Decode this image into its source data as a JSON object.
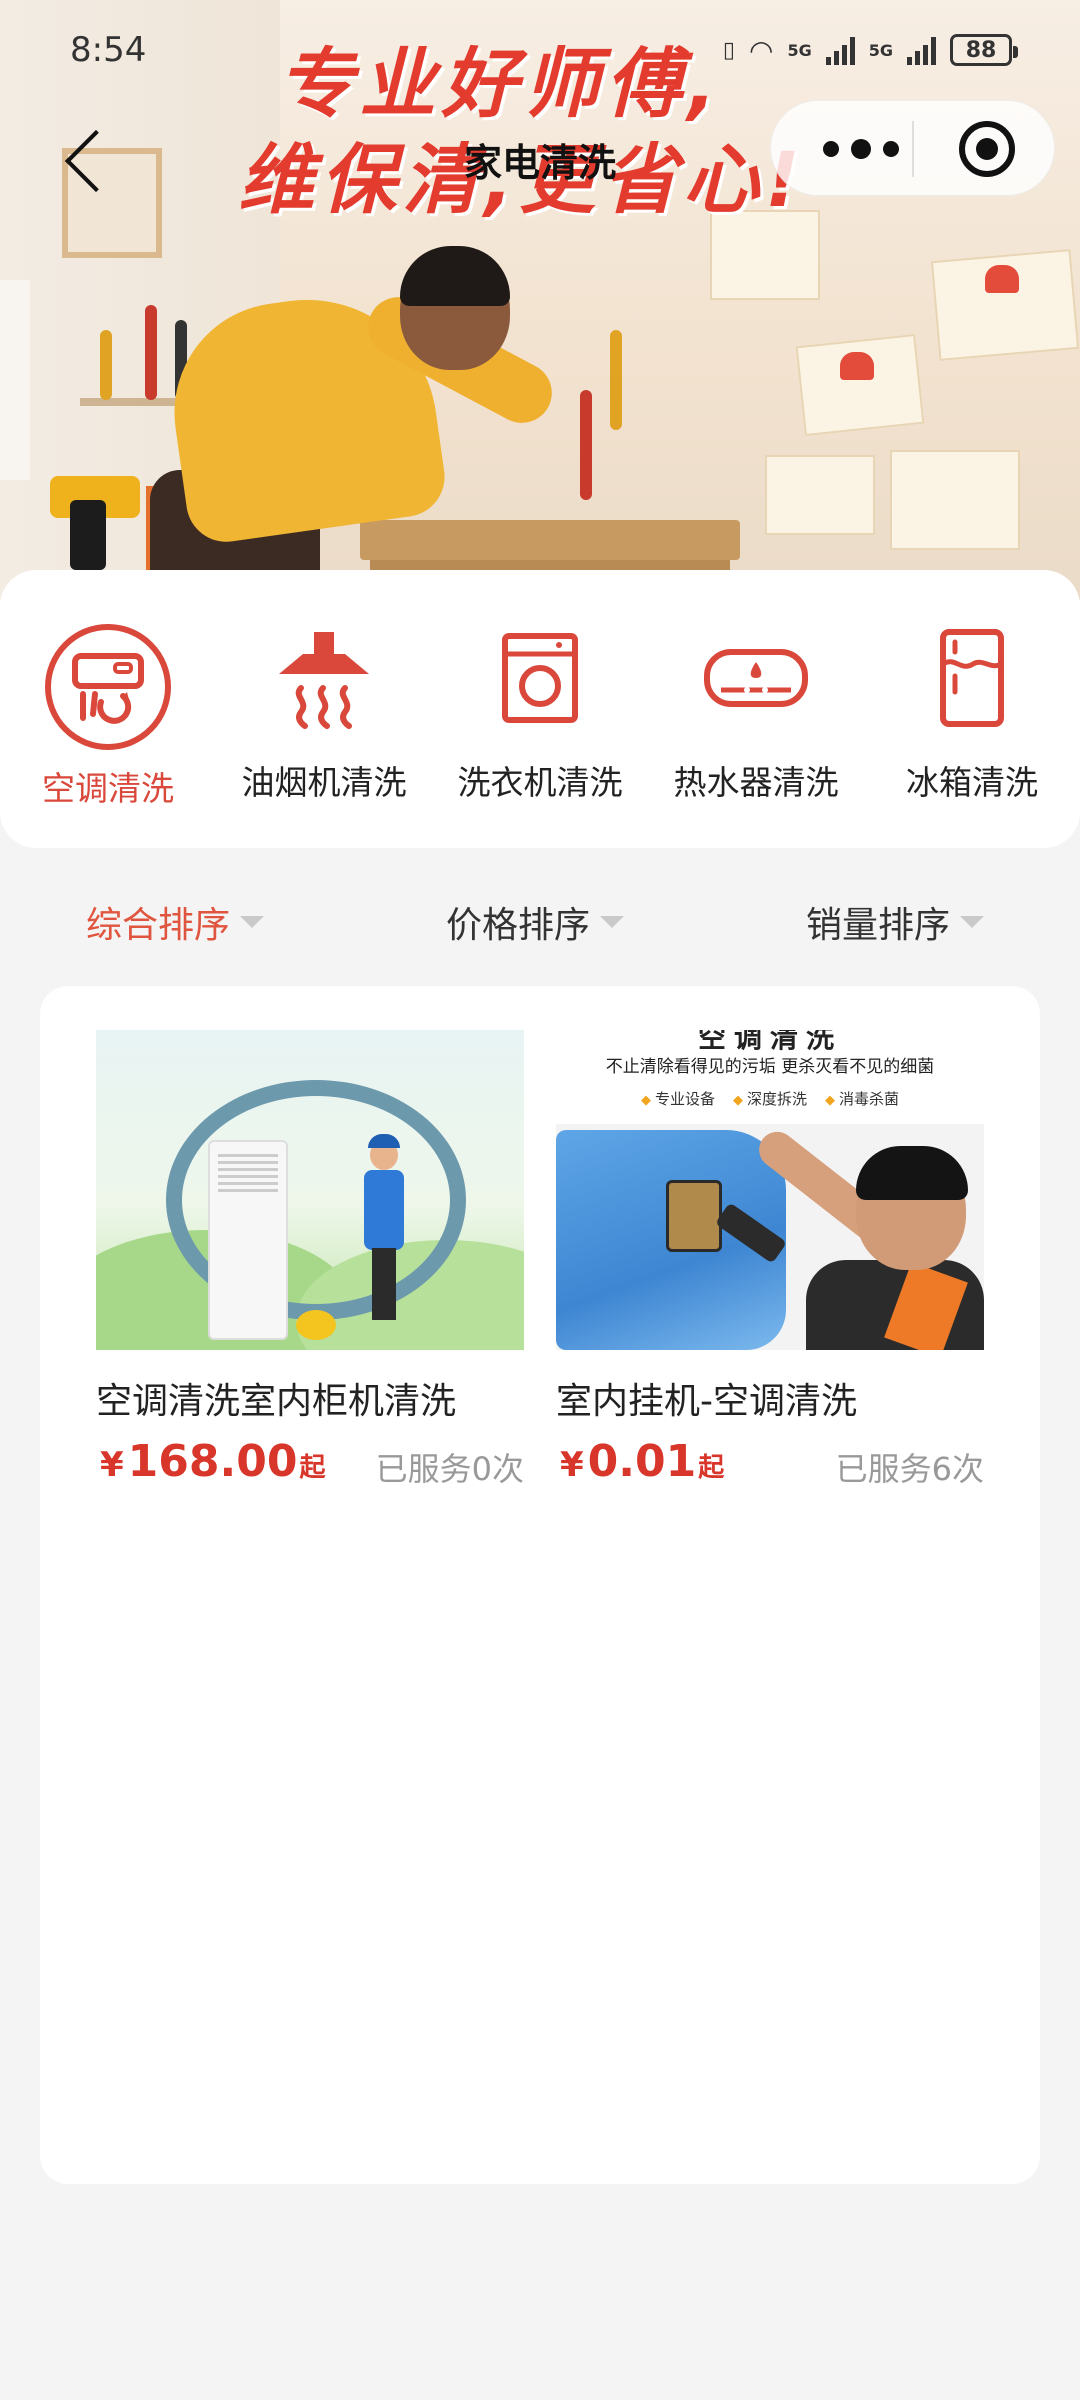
{
  "status_bar": {
    "time": "8:54",
    "network_a": "5G",
    "network_b": "5G",
    "battery": "88"
  },
  "banner": {
    "line1": "专业好师傅,",
    "line2": "维保清,更省心!"
  },
  "nav": {
    "title": "家电清洗"
  },
  "categories": [
    {
      "label": "空调清洗",
      "icon": "air-conditioner-icon",
      "active": true
    },
    {
      "label": "油烟机清洗",
      "icon": "range-hood-icon",
      "active": false
    },
    {
      "label": "洗衣机清洗",
      "icon": "washing-machine-icon",
      "active": false
    },
    {
      "label": "热水器清洗",
      "icon": "water-heater-icon",
      "active": false
    },
    {
      "label": "冰箱清洗",
      "icon": "refrigerator-icon",
      "active": false
    }
  ],
  "sort": [
    {
      "label": "综合排序",
      "active": true
    },
    {
      "label": "价格排序",
      "active": false
    },
    {
      "label": "销量排序",
      "active": false
    }
  ],
  "products": [
    {
      "name": "空调清洗室内柜机清洗",
      "currency": "¥",
      "price": "168.00",
      "price_suffix": "起",
      "served": "已服务0次"
    },
    {
      "name": "室内挂机-空调清洗",
      "currency": "¥",
      "price": "0.01",
      "price_suffix": "起",
      "served": "已服务6次",
      "image_text": {
        "headline": "空调清洗",
        "subtitle": "不止清除看得见的污垢 更杀灭看不见的细菌",
        "tags": [
          "专业设备",
          "深度拆洗",
          "消毒杀菌"
        ]
      }
    }
  ],
  "colors": {
    "accent": "#d9483b",
    "price": "#d8362a",
    "background": "#f4f4f4"
  }
}
